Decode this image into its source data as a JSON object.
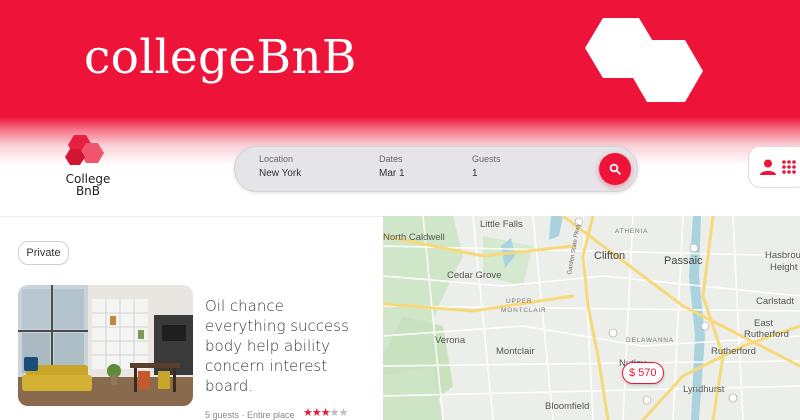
{
  "banner": {
    "title": "collegeBnB"
  },
  "brand": {
    "line1": "College",
    "line2": "BnB"
  },
  "search": {
    "location": {
      "label": "Location",
      "value": "New York"
    },
    "dates": {
      "label": "Dates",
      "value": "Mar 1"
    },
    "guests": {
      "label": "Guests",
      "value": "1"
    },
    "button_icon": "search-icon"
  },
  "user_menu": {
    "icons": [
      "user-icon",
      "grid-icon"
    ]
  },
  "filter": {
    "chip_label": "Private"
  },
  "listing": {
    "title": "Oil chance everything success body help ability concern interest board.",
    "meta": "5 guests · Entire place",
    "rating": 3,
    "rating_max": 5
  },
  "map": {
    "labels": {
      "little_falls": "Little Falls",
      "north_caldwell": "North Caldwell",
      "athenia": "ATHENIA",
      "clifton": "Clifton",
      "passaic": "Passaic",
      "hasbrouck": "Hasbrou",
      "heights": "Height",
      "cedar_grove": "Cedar Grove",
      "upper_montclair_1": "UPPER",
      "upper_montclair_2": "MONTCLAIR",
      "garden_state": "Garden State Pkwy",
      "carlstadt": "Carlstadt",
      "east_rutherford_1": "East",
      "east_rutherford_2": "Rutherford",
      "verona": "Verona",
      "montclair": "Montclair",
      "delawanna": "DELAWANNA",
      "rutherford": "Rutherford",
      "nutley": "Nutley",
      "lyndhurst": "Lyndhurst",
      "bloomfield": "Bloomfield"
    },
    "price_pin": "$ 570"
  },
  "colors": {
    "brand": "#ee1439",
    "map_bg": "#eceeea",
    "highway": "#f6d97a"
  }
}
